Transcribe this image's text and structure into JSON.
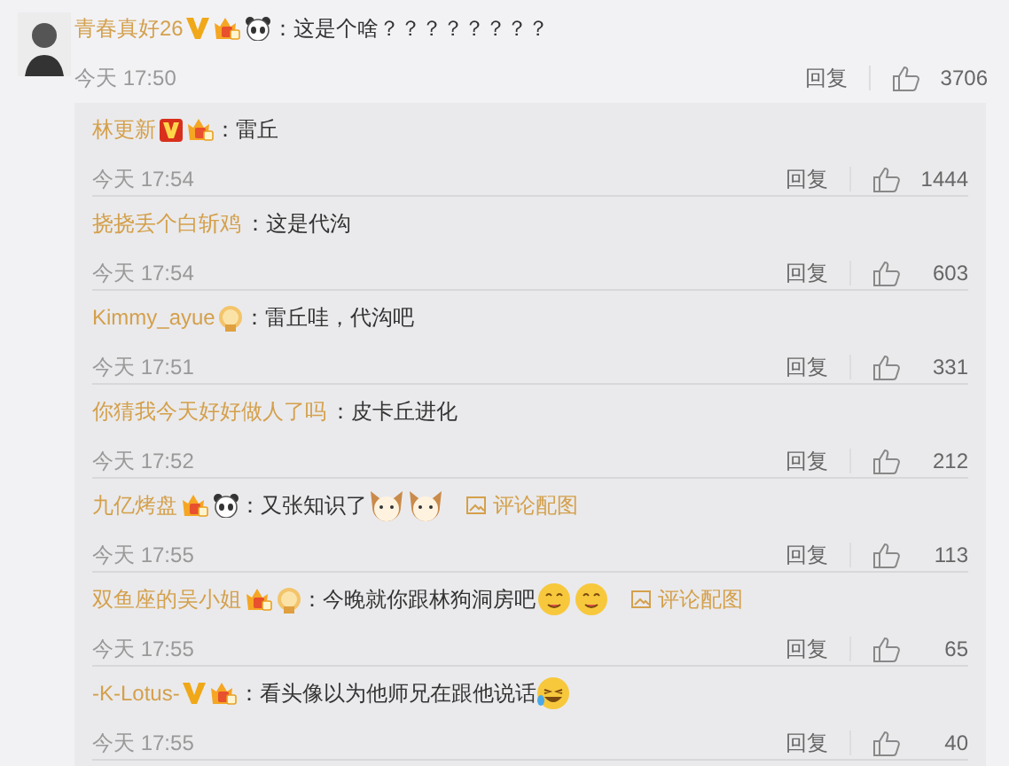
{
  "comment": {
    "name": "青春真好26",
    "badges": [
      {
        "kind": "vip-gold"
      },
      {
        "kind": "crown"
      },
      {
        "kind": "panda"
      }
    ],
    "text": "：这是个啥？？？？？？？？",
    "time": "今天 17:50",
    "reply": "回复",
    "likes": "3706"
  },
  "replies": [
    {
      "name": "林更新",
      "badges": [
        {
          "kind": "vip-red"
        },
        {
          "kind": "crown"
        }
      ],
      "text": "：雷丘",
      "time": "今天 17:54",
      "reply": "回复",
      "likes": "1444"
    },
    {
      "name": "挠挠丢个白斩鸡",
      "text": "：这是代沟",
      "time": "今天 17:54",
      "reply": "回复",
      "likes": "603"
    },
    {
      "name": "Kimmy_ayue",
      "badges": [
        {
          "kind": "medal"
        }
      ],
      "text": "：雷丘哇，代沟吧",
      "time": "今天 17:51",
      "reply": "回复",
      "likes": "331"
    },
    {
      "name": "你猜我今天好好做人了吗",
      "text": "：皮卡丘进化",
      "time": "今天 17:52",
      "reply": "回复",
      "likes": "212"
    },
    {
      "name": "九亿烤盘",
      "badges": [
        {
          "kind": "crown"
        },
        {
          "kind": "panda"
        }
      ],
      "text": "：又张知识了",
      "emojis": [
        {
          "kind": "cat"
        },
        {
          "kind": "cat"
        }
      ],
      "pic_link": "评论配图",
      "time": "今天 17:55",
      "reply": "回复",
      "likes": "113"
    },
    {
      "name": "双鱼座的吴小姐",
      "badges": [
        {
          "kind": "crown"
        },
        {
          "kind": "medal"
        }
      ],
      "text": "：今晚就你跟林狗洞房吧",
      "emojis": [
        {
          "kind": "yum"
        },
        {
          "kind": "yum"
        }
      ],
      "pic_link": "评论配图",
      "time": "今天 17:55",
      "reply": "回复",
      "likes": "65"
    },
    {
      "name": "-K-Lotus-",
      "badges": [
        {
          "kind": "vip-gold"
        },
        {
          "kind": "crown"
        }
      ],
      "text": "：看头像以为他师兄在跟他说话",
      "emojis": [
        {
          "kind": "laugh"
        }
      ],
      "time": "今天 17:55",
      "reply": "回复",
      "likes": "40"
    }
  ]
}
